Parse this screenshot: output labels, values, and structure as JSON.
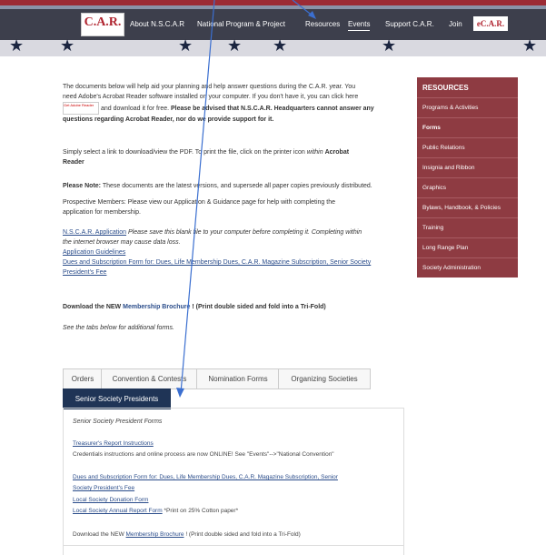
{
  "nav": {
    "logo_text": "C.A.R.",
    "items": [
      "About N.S.C.A.R",
      "National Program & Project",
      "Resources",
      "Events",
      "Support C.A.R.",
      "Join"
    ],
    "logo2_text": "eC.A.R."
  },
  "main": {
    "p1a": "The documents below will help aid your planning and help answer questions during the C.A.R. year. You",
    "p1b": "need Adobe's Acrobat Reader software installed on your computer. If you don't have it, you can click here",
    "adobe_badge": "Get Adobe Reader",
    "p1c_plain": "and download it for free.",
    "p1c_bold": "Please be advised that N.S.C.A.R. Headquarters cannot answer any",
    "p1d_bold": "questions regarding Acrobat Reader, nor do we provide support for it.",
    "p2a": "Simply select a link to download/view the PDF. To print the file, click on the printer icon",
    "p2a_italic": "within",
    "p2a_bold": "Acrobat",
    "p2b_bold": "Reader",
    "p3_bold": "Please Note:",
    "p3_rest": "These documents are the latest versions, and supersede all paper copies previously distributed.",
    "p4a": "Prospective Members: Please view our Application & Guidance page for help with completing the",
    "p4b": "application for membership.",
    "app_link": "N.S.C.A.R. Application",
    "app_note1": "Please save this blank file to your computer before completing it. Completing within",
    "app_note2": "the internet browser may cause data loss.",
    "guidelines_link": "Application Guidelines",
    "dues_link1": "Dues and Subscription Form for: Dues, Life Membership Dues, C.A.R. Magazine Subscription, Senior Society",
    "dues_link2": "President's Fee",
    "download_a": "Download the NEW",
    "download_link": "Membership Brochure",
    "download_b": "! (Print double sided and fold into a Tri-Fold)",
    "see_tabs": "See the tabs below for additional forms."
  },
  "sidebar": {
    "heading": "RESOURCES",
    "items": [
      "Programs & Activities",
      "Forms",
      "Public Relations",
      "Insignia and Ribbon",
      "Graphics",
      "Bylaws, Handbook, & Policies",
      "Training",
      "Long Range Plan",
      "Society Administration"
    ]
  },
  "tabs": [
    "Orders",
    "Convention & Contests",
    "Nomination Forms",
    "Organizing Societies",
    "Senior Society Presidents"
  ],
  "panel": {
    "title": "Senior Society President Forms",
    "treasurer_link": "Treasurer's Report Instructions",
    "credentials": "Credentials instructions and online process are now ONLINE! See \"Events\"-->\"National Convention\"",
    "dues_link1": "Dues and Subscription Form for: Dues, Life Membership Dues, C.A.R. Magazine Subscription, Senior",
    "dues_link2": "Society President's Fee",
    "donation_link": "Local Society Donation Form",
    "annual_a": "Local Society Annual Report Form",
    "annual_b": "*Print on 25% Cotton paper*",
    "download_a": "Download the NEW",
    "download_link": "Membership Brochure",
    "download_b": "! (Print double sided and fold into a Tri-Fold)"
  },
  "colors": {
    "sidebar": "#8e3b42",
    "active_tab": "#1f3456",
    "link": "#2a4c8a",
    "arrow": "#3b6fd0"
  }
}
